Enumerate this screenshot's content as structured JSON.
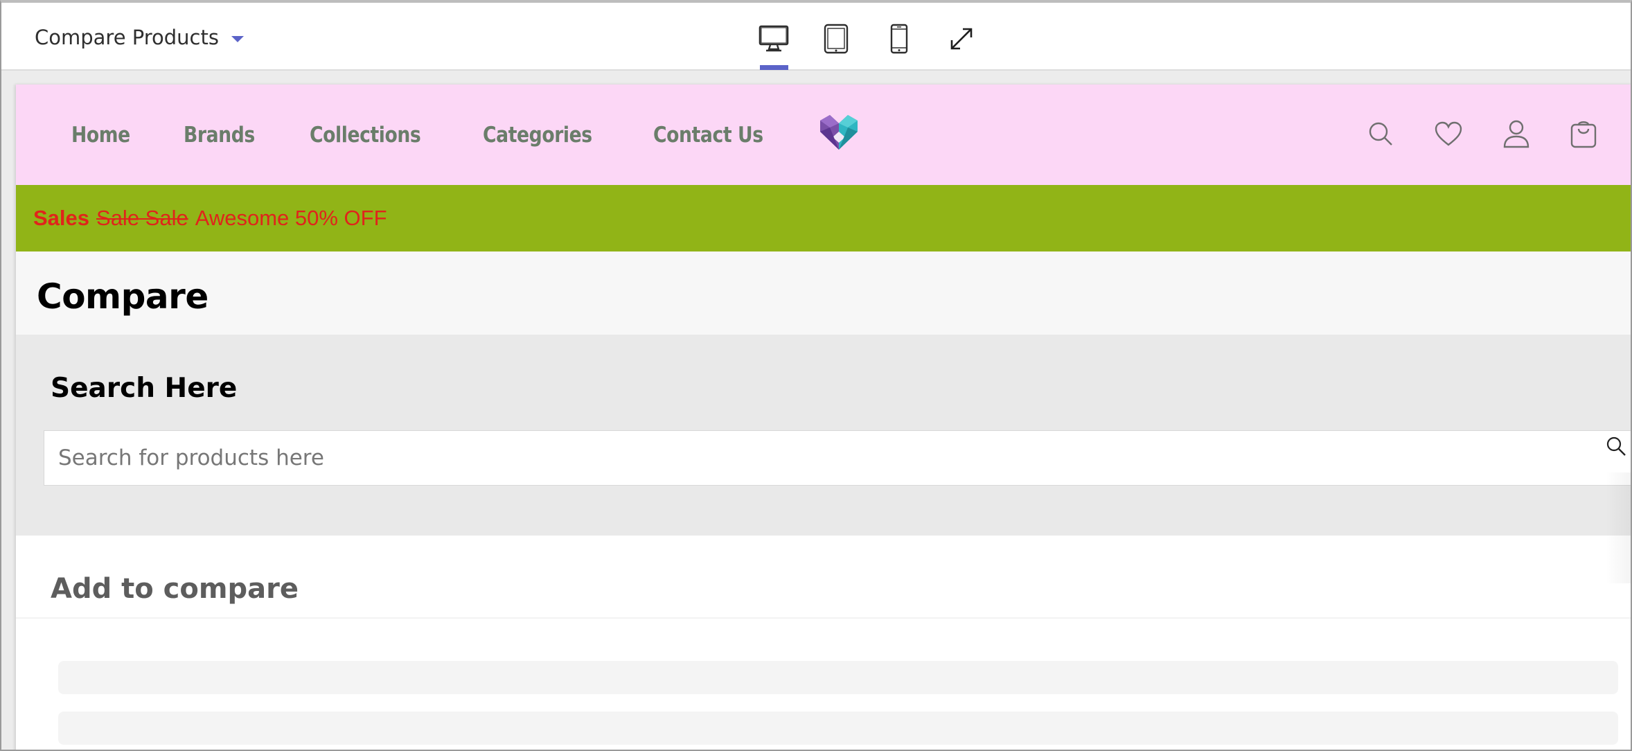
{
  "editor": {
    "page_selector": "Compare Products",
    "devices": [
      "desktop-icon",
      "tablet-icon",
      "mobile-icon",
      "fullscreen-icon"
    ],
    "active_device": "desktop",
    "accent_color": "#5b63c8"
  },
  "site": {
    "header_bg": "#fcd7f6",
    "nav": [
      "Home",
      "Brands",
      "Collections",
      "Categories",
      "Contact Us"
    ],
    "icons": [
      "search-icon",
      "heart-icon",
      "user-icon",
      "bag-icon"
    ]
  },
  "promo": {
    "bold": "Sales",
    "strike": "Sale Sale",
    "text": "Awesome 50% OFF",
    "bg": "#91b417",
    "color": "#e0241b"
  },
  "page": {
    "title": "Compare",
    "search_heading": "Search Here",
    "search_placeholder": "Search for products here",
    "compare_heading": "Add to compare"
  }
}
